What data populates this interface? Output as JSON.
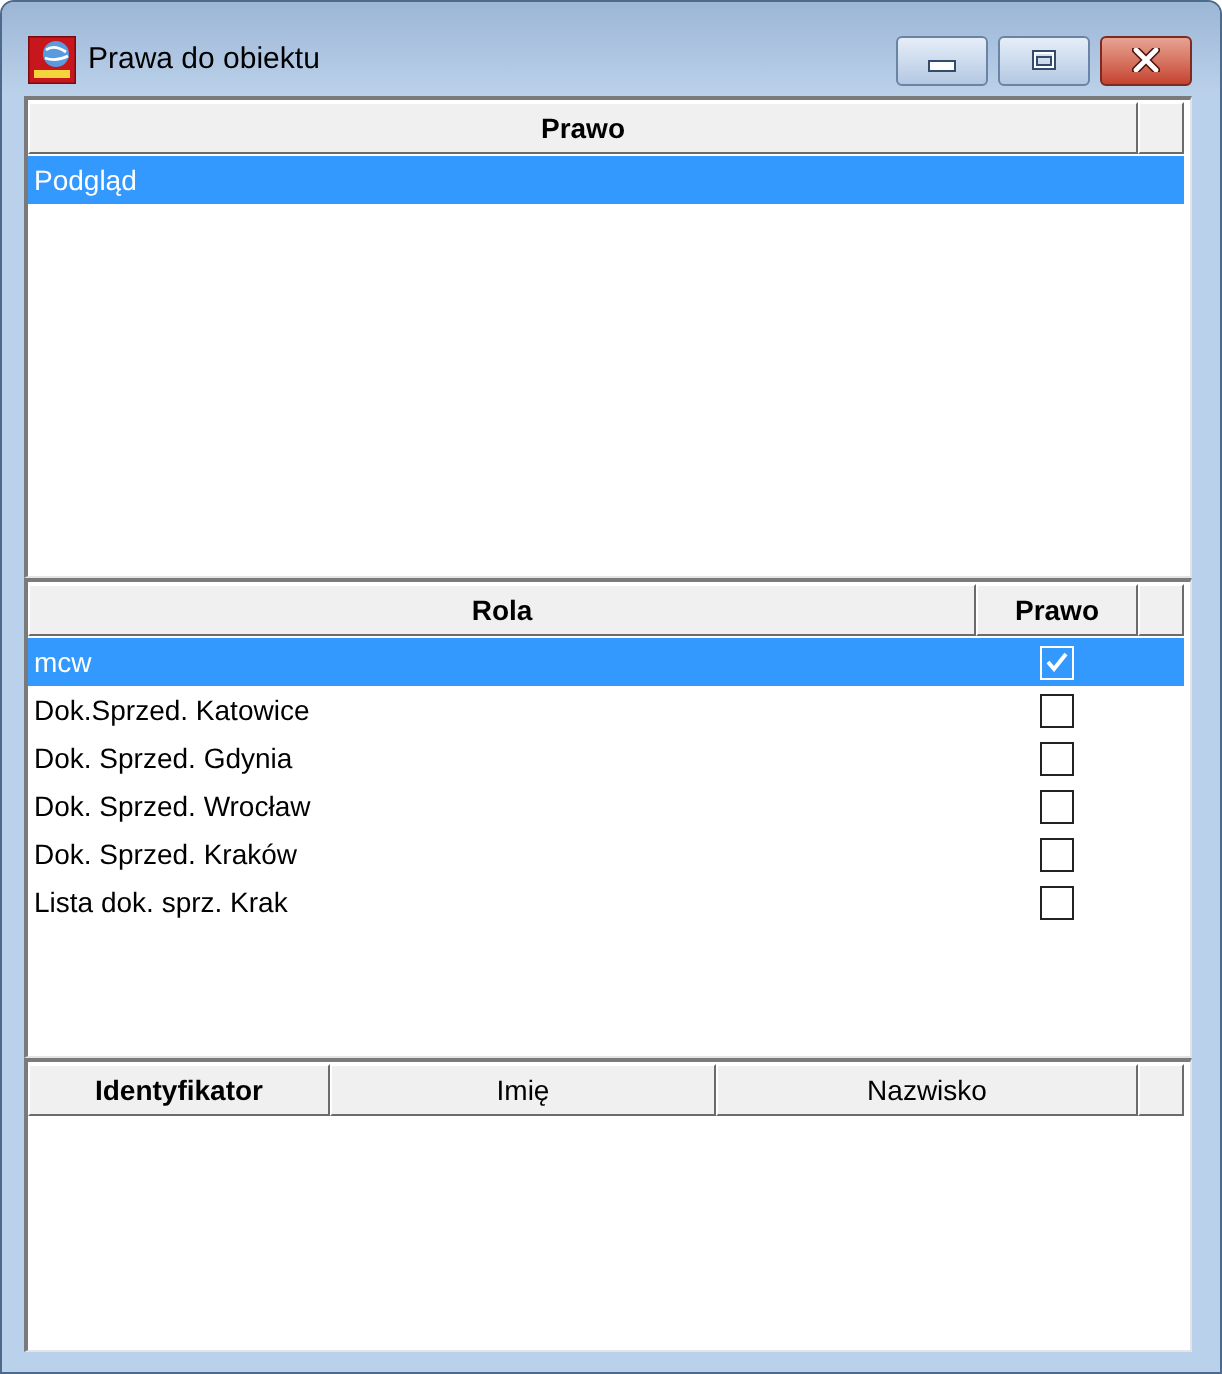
{
  "window": {
    "title": "Prawa do obiektu"
  },
  "rights_table": {
    "columns": [
      {
        "label": "Prawo",
        "bold": true
      }
    ],
    "rows": [
      {
        "cells": [
          "Podgląd"
        ],
        "selected": true
      }
    ]
  },
  "roles_table": {
    "columns": [
      {
        "label": "Rola",
        "bold": true
      },
      {
        "label": "Prawo",
        "bold": true
      }
    ],
    "rows": [
      {
        "name": "mcw",
        "checked": true,
        "selected": true
      },
      {
        "name": "Dok.Sprzed. Katowice",
        "checked": false,
        "selected": false
      },
      {
        "name": "Dok. Sprzed. Gdynia",
        "checked": false,
        "selected": false
      },
      {
        "name": "Dok. Sprzed. Wrocław",
        "checked": false,
        "selected": false
      },
      {
        "name": "Dok. Sprzed. Kraków",
        "checked": false,
        "selected": false
      },
      {
        "name": "Lista dok. sprz. Krak",
        "checked": false,
        "selected": false
      }
    ]
  },
  "users_table": {
    "columns": [
      {
        "label": "Identyfikator",
        "bold": true
      },
      {
        "label": "Imię",
        "bold": false
      },
      {
        "label": "Nazwisko",
        "bold": false
      }
    ]
  }
}
